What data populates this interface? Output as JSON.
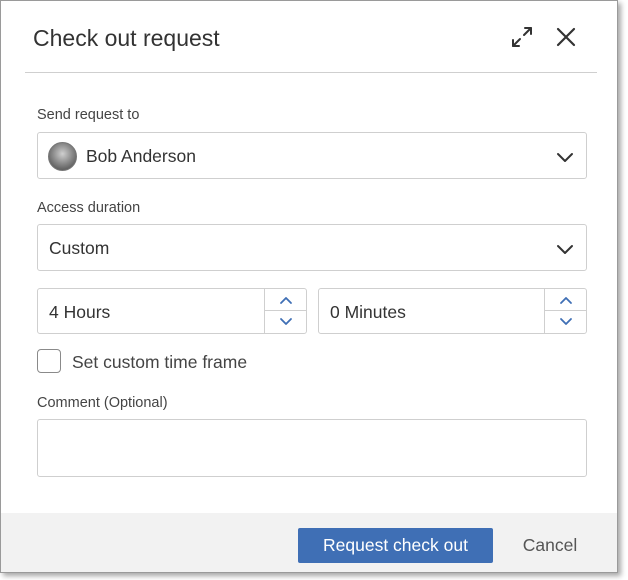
{
  "dialog": {
    "title": "Check out request",
    "expand_icon": "expand-icon",
    "close_icon": "close-icon"
  },
  "send_request": {
    "label": "Send request to",
    "value": "Bob Anderson",
    "avatar_icon": "user-avatar"
  },
  "access_duration": {
    "label": "Access duration",
    "value": "Custom"
  },
  "hours": {
    "value": "4 Hours"
  },
  "minutes": {
    "value": "0 Minutes"
  },
  "custom_time_frame": {
    "label": "Set custom time frame",
    "checked": false
  },
  "comment": {
    "label": "Comment (Optional)",
    "value": ""
  },
  "footer": {
    "primary_label": "Request check out",
    "cancel_label": "Cancel"
  },
  "colors": {
    "primary": "#3f6fb5",
    "footer_bg": "#f2f2f2",
    "border": "#cfcfcf",
    "accent_arrows": "#3f6fb5"
  }
}
